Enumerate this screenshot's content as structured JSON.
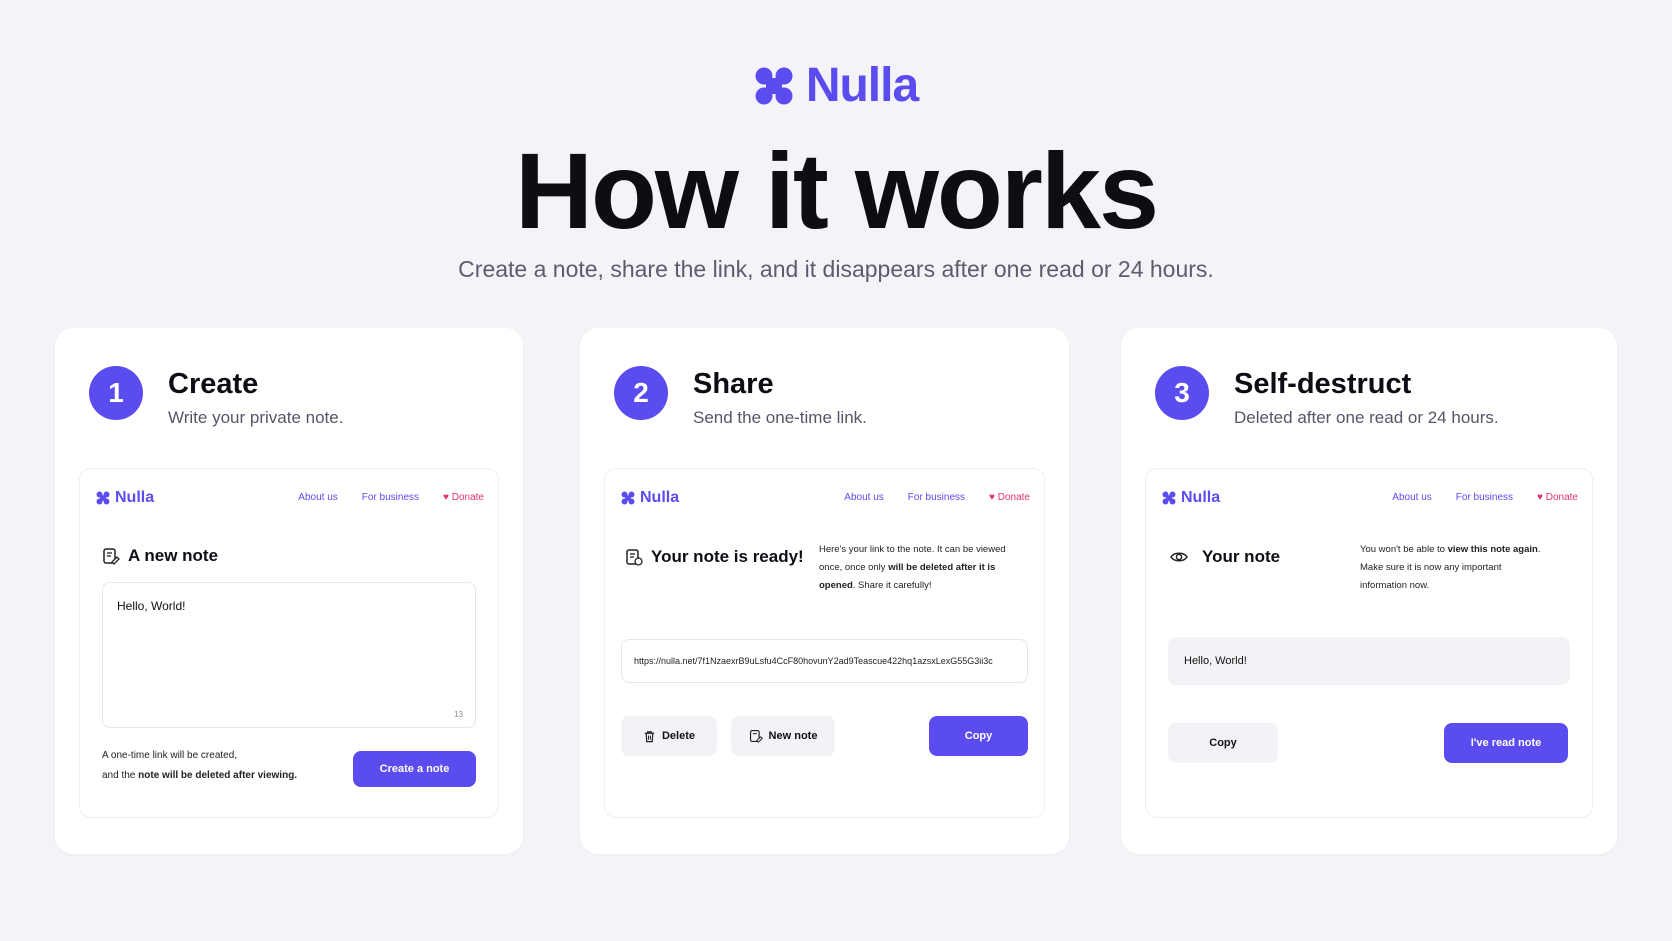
{
  "hero": {
    "brand": "Nulla",
    "headline": "How it works",
    "subtitle": "Create a note, share the link, and it disappears after one read or 24 hours."
  },
  "colors": {
    "accent": "#5b4cf0",
    "donate": "#e0356e",
    "background": "#f3f3f8"
  },
  "nav": {
    "about": "About us",
    "business": "For business",
    "donate": "Donate"
  },
  "steps": [
    {
      "number": "1",
      "title": "Create",
      "description": "Write your private note.",
      "mock": {
        "brand": "Nulla",
        "heading": "A new note",
        "textarea_value": "Hello, World!",
        "counter": "13",
        "footer_line1": "A one-time link will be created,",
        "footer_line2_prefix": "and the ",
        "footer_line2_bold": "note will be deleted after viewing.",
        "button": "Create a note"
      }
    },
    {
      "number": "2",
      "title": "Share",
      "description": "Send the one-time link.",
      "mock": {
        "brand": "Nulla",
        "heading": "Your note is ready!",
        "info_line1": "Here's your link to the note. It can be viewed",
        "info_line2_prefix": "once, once only ",
        "info_line2_bold": "will be deleted after it is",
        "info_line3_bold": "opened",
        "info_line3_suffix": ". Share it carefully!",
        "link": "https://nulla.net/7f1NzaexrB9uLsfu4CcF80hovunY2ad9Teascue422hq1azsxLexG55G3ii3c",
        "delete": "Delete",
        "new_note": "New note",
        "copy": "Copy"
      }
    },
    {
      "number": "3",
      "title": "Self-destruct",
      "description": "Deleted after one read or 24 hours.",
      "mock": {
        "brand": "Nulla",
        "heading": "Your note",
        "info_line1_prefix": "You won't be able to ",
        "info_line1_bold": "view this note again",
        "info_line1_suffix": ".",
        "info_line2": "Make sure it is now any important",
        "info_line3": "information now.",
        "note_value": "Hello, World!",
        "copy": "Copy",
        "read": "I've read note"
      }
    }
  ]
}
